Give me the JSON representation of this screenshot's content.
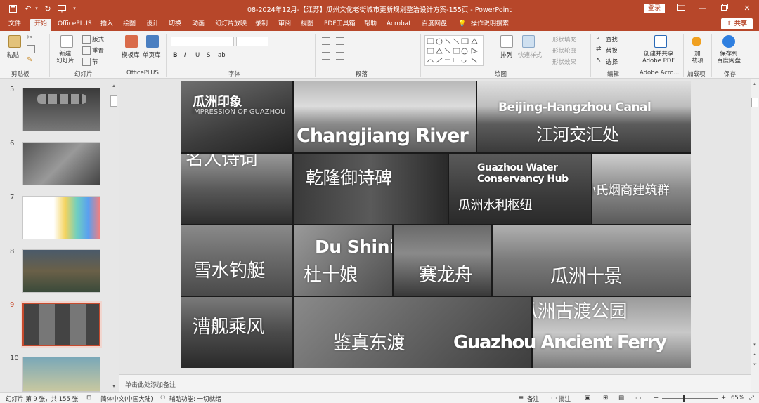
{
  "window": {
    "title": "08-2024年12月-【江苏】瓜州文化老街城市更新规划整治设计方案-155页  -  PowerPoint",
    "login_label": "登录",
    "share_label": "共享"
  },
  "tabs": [
    "文件",
    "开始",
    "OfficePLUS",
    "插入",
    "绘图",
    "设计",
    "切换",
    "动画",
    "幻灯片放映",
    "录制",
    "审阅",
    "视图",
    "PDF工具箱",
    "帮助",
    "Acrobat",
    "百度网盘",
    "操作说明搜索"
  ],
  "active_tab": "开始",
  "ribbon": {
    "clipboard": {
      "label": "剪贴板",
      "paste": "粘贴"
    },
    "slides": {
      "label": "幻灯片",
      "new_slide": "新建\n幻灯片",
      "layout": "版式",
      "reset": "重置",
      "section": "节"
    },
    "officeplus": {
      "label": "OfficePLUS",
      "template": "模板库",
      "single": "单页库"
    },
    "font": {
      "label": "字体",
      "bold": "B",
      "italic": "I",
      "underline": "U",
      "strike": "S",
      "shadow": "ab"
    },
    "paragraph": {
      "label": "段落"
    },
    "drawing": {
      "label": "绘图",
      "arrange": "排列",
      "quick_style": "快速样式",
      "fill": "形状填充",
      "outline": "形状轮廓",
      "effect": "形状效果"
    },
    "editing": {
      "label": "编辑",
      "find": "查找",
      "replace": "替换",
      "select": "选择"
    },
    "adobe": {
      "label": "Adobe Acro...",
      "create": "创建并共享\nAdobe PDF"
    },
    "addins": {
      "label": "加载项",
      "addin": "加\n载项"
    },
    "save": {
      "label": "保存",
      "save_baidu": "保存到\n百度网盘"
    }
  },
  "thumbnails": [
    {
      "num": "5",
      "selected": false
    },
    {
      "num": "6",
      "selected": false
    },
    {
      "num": "7",
      "selected": false
    },
    {
      "num": "8",
      "selected": false
    },
    {
      "num": "9",
      "selected": true
    },
    {
      "num": "10",
      "selected": false
    }
  ],
  "slide": {
    "tiles": [
      {
        "id": "guazhou-impression",
        "texts": [
          "瓜洲印象",
          "IMPRESSION OF GUAZHOU"
        ]
      },
      {
        "id": "changjiang-river",
        "texts": [
          "Changjiang River"
        ]
      },
      {
        "id": "canal",
        "texts": [
          "Beijing-Hangzhou Canal",
          "江河交汇处"
        ]
      },
      {
        "id": "celebrity-poems",
        "texts": [
          "名人诗词"
        ]
      },
      {
        "id": "qianlong-stele",
        "texts": [
          "乾隆御诗碑"
        ]
      },
      {
        "id": "water-hub",
        "texts": [
          "Guazhou Water",
          "Conservancy Hub",
          "瓜洲水利枢纽"
        ]
      },
      {
        "id": "sun-buildings",
        "texts": [
          "孙氏烟商建筑群"
        ]
      },
      {
        "id": "snow-fishing",
        "texts": [
          "雪水钓艇"
        ]
      },
      {
        "id": "du-shiniang",
        "texts": [
          "Du Shiniang",
          "杜十娘"
        ]
      },
      {
        "id": "dragon-boat",
        "texts": [
          "赛龙舟"
        ]
      },
      {
        "id": "ten-views",
        "texts": [
          "瓜洲十景"
        ]
      },
      {
        "id": "canal-wind",
        "texts": [
          "漕舰乘风"
        ]
      },
      {
        "id": "jianzhen",
        "texts": [
          "鉴真东渡"
        ]
      },
      {
        "id": "ferry-park",
        "texts": [
          "瓜洲古渡公园",
          "Guazhou Ancient Ferry"
        ]
      }
    ]
  },
  "notes_placeholder": "单击此处添加备注",
  "status": {
    "slide_info": "幻灯片 第 9 张，共 155 张",
    "language": "简体中文(中国大陆)",
    "accessibility": "辅助功能: 一切就绪",
    "notes": "备注",
    "comments": "批注",
    "zoom": "65%"
  },
  "colors": {
    "accent": "#b7472a",
    "ribbon_bg": "#f3f3f3",
    "canvas_bg": "#e6e6e6"
  }
}
